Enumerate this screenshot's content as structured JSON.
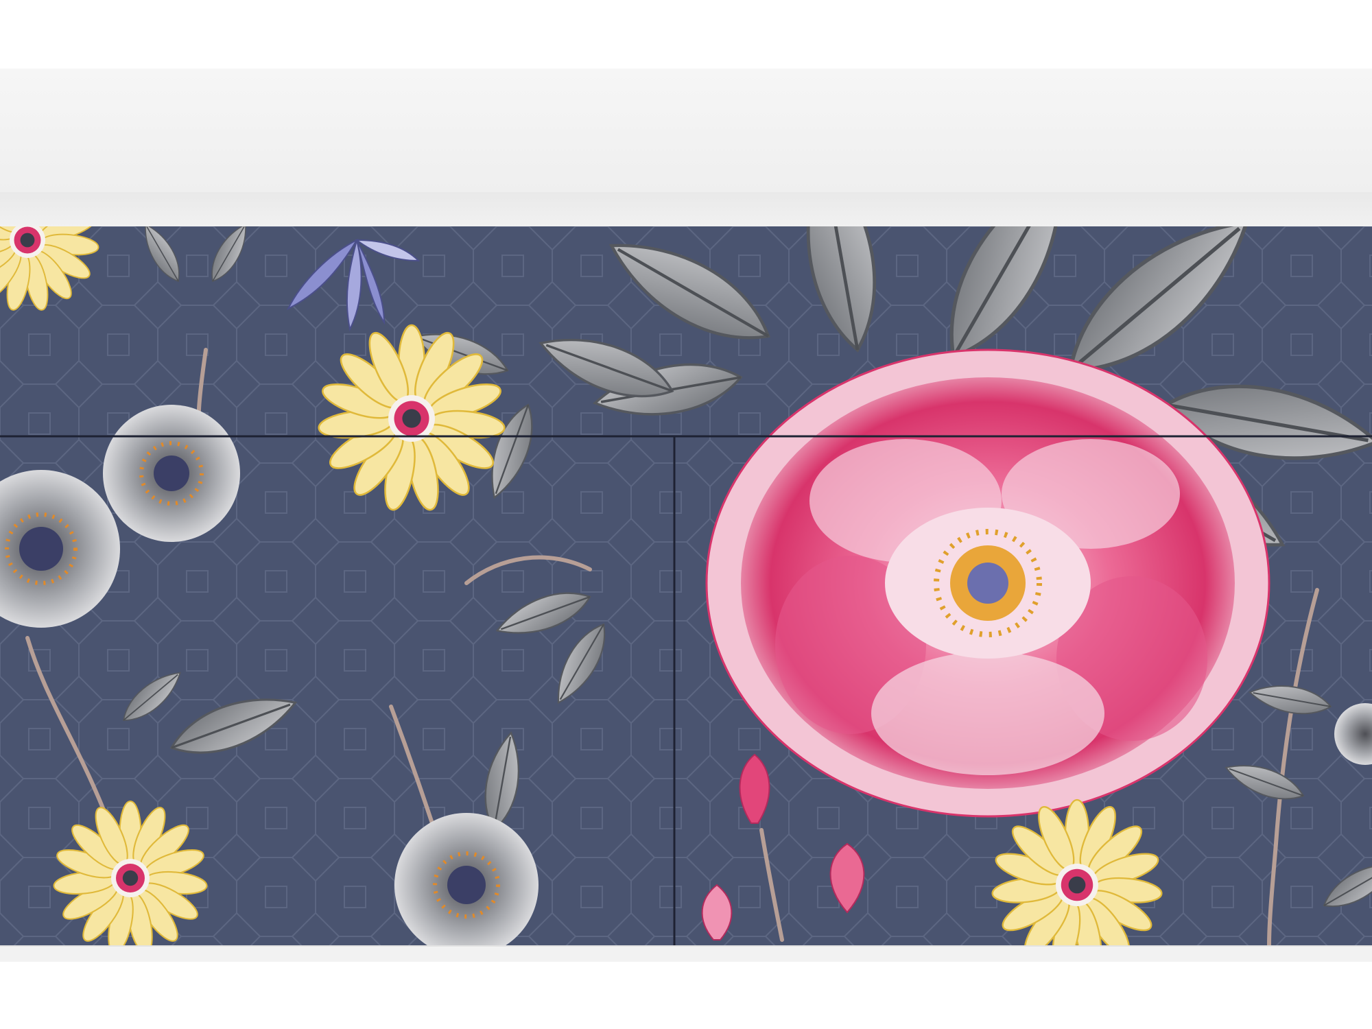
{
  "image": {
    "subject": "sideboard-floral-front",
    "colors": {
      "background": "#ffffff",
      "cabinet_top": "#f3f3f3",
      "panel_navy": "#4a5470",
      "lattice": "#59637f",
      "peony_pink": "#e2467a",
      "peony_light": "#f6c8d8",
      "daisy_yellow": "#f1d25a",
      "leaf_grey": "#8e9196",
      "bluebell": "#8b8fd0",
      "branch": "#b79f96"
    },
    "panels": [
      "top-drawer",
      "lower-left-door",
      "lower-right-door"
    ]
  }
}
